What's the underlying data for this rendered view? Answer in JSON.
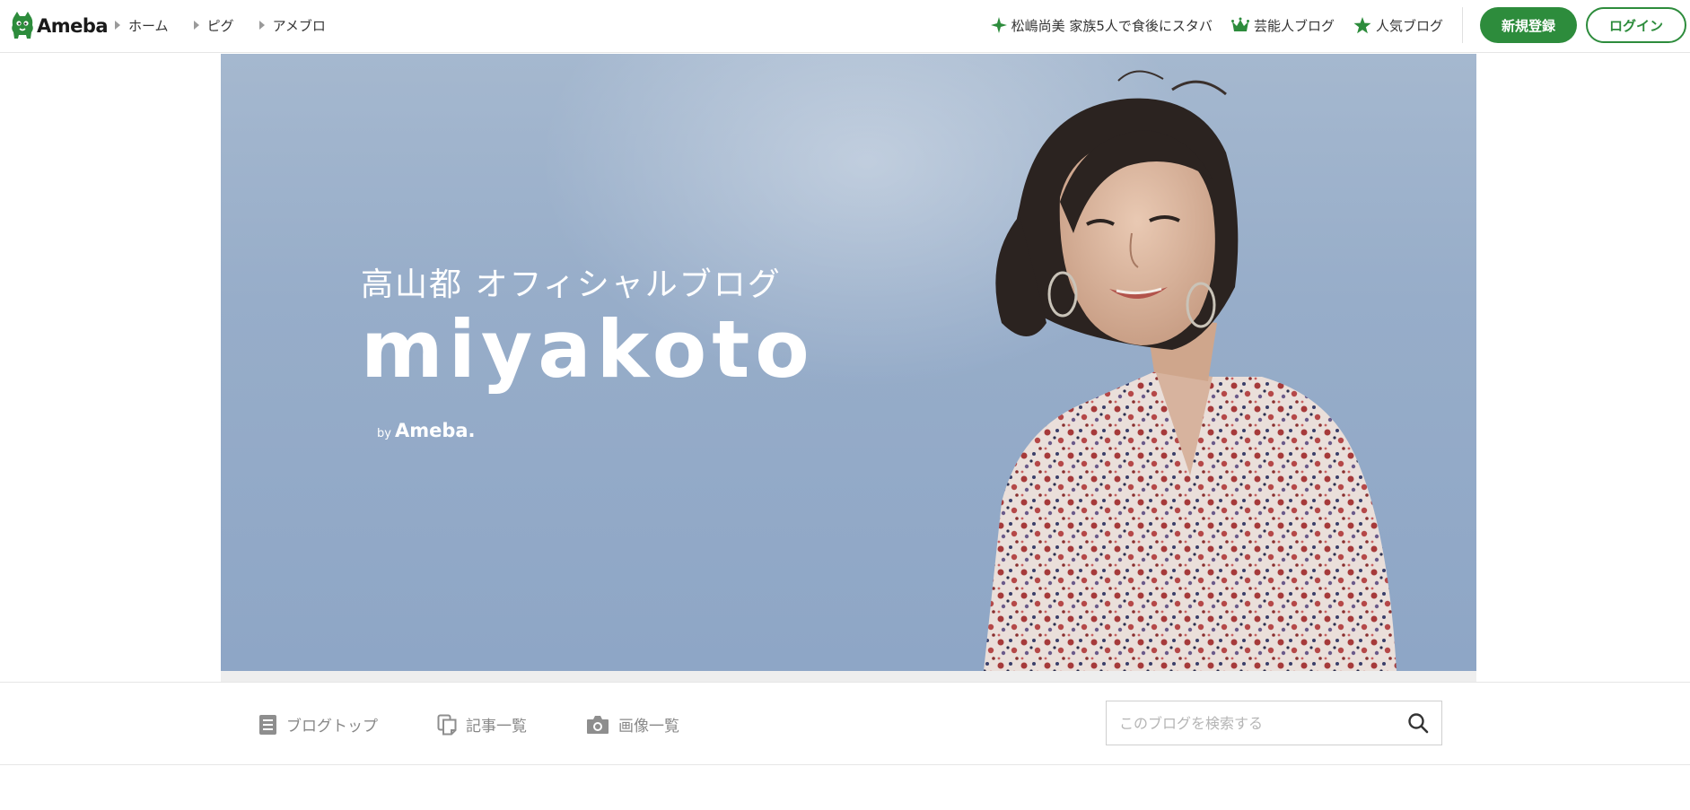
{
  "header": {
    "logo_text": "Ameba",
    "breadcrumbs": [
      {
        "label": "ホーム"
      },
      {
        "label": "ピグ"
      },
      {
        "label": "アメブロ"
      }
    ],
    "right_links": [
      {
        "label": "松嶋尚美 家族5人で食後にスタバ",
        "icon": "sparkle-icon"
      },
      {
        "label": "芸能人ブログ",
        "icon": "crown-icon"
      },
      {
        "label": "人気ブログ",
        "icon": "star-icon"
      }
    ],
    "register_label": "新規登録",
    "login_label": "ログイン",
    "accent_color": "#2d8c3c"
  },
  "banner": {
    "title": "高山都 オフィシャルブログ",
    "blog_name": "miyakoto",
    "by": "by",
    "brand": "Ameba."
  },
  "subnav": {
    "tabs": [
      {
        "label": "ブログトップ",
        "icon": "document-icon"
      },
      {
        "label": "記事一覧",
        "icon": "copy-icon"
      },
      {
        "label": "画像一覧",
        "icon": "camera-icon"
      }
    ],
    "search_placeholder": "このブログを検索する"
  }
}
